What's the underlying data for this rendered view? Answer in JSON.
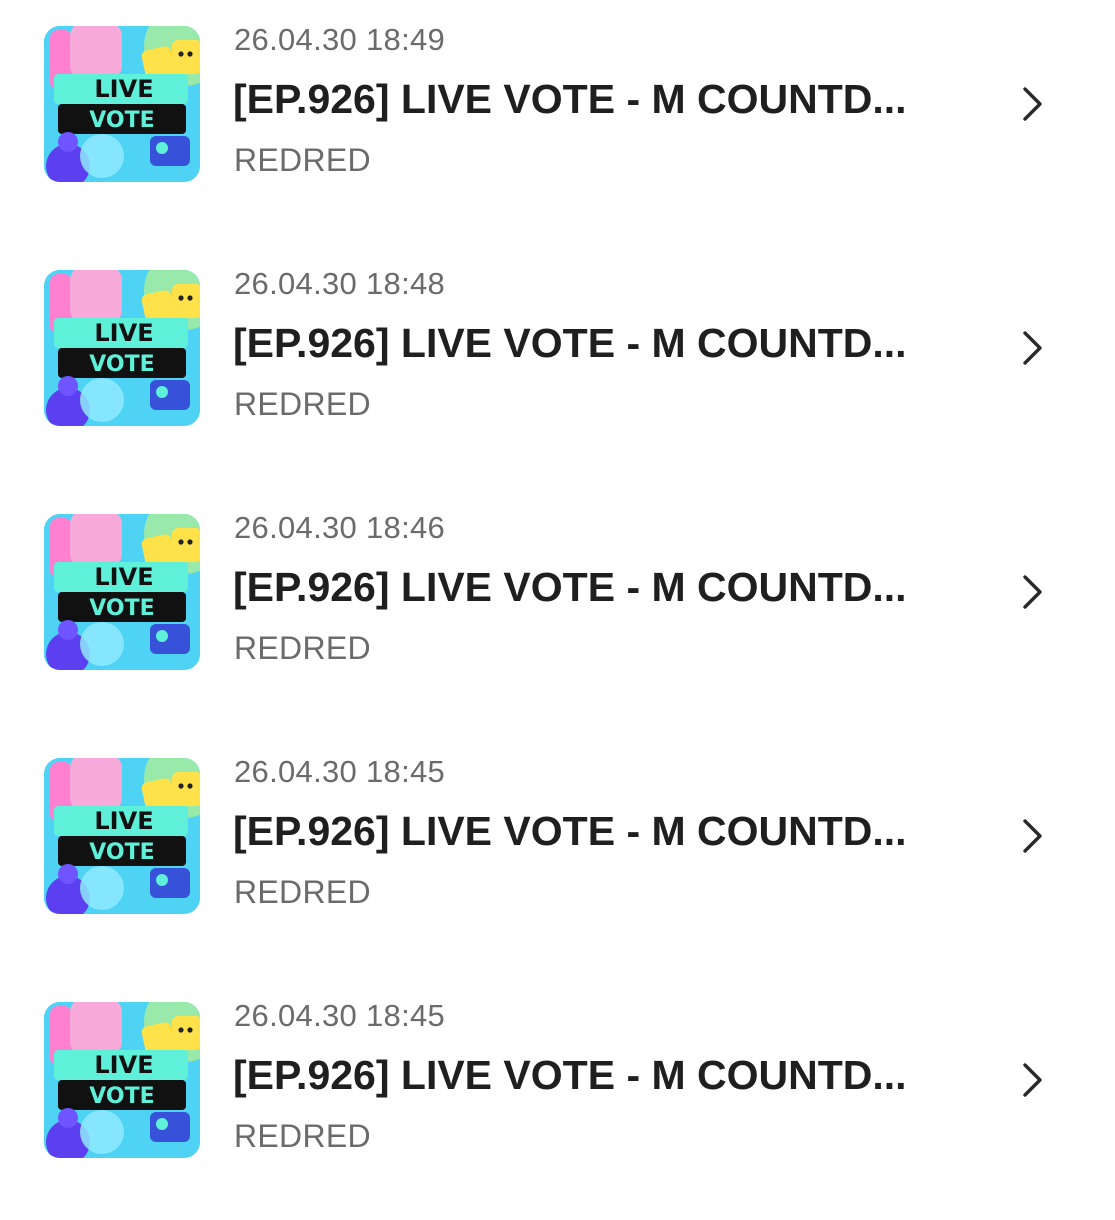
{
  "items": [
    {
      "date": "26.04.30 18:49",
      "title": "[EP.926] LIVE VOTE - M COUNTD...",
      "sender": "REDRED",
      "thumb_top": "LIVE",
      "thumb_bottom": "VOTE",
      "chevron_icon": "chevron-right-icon"
    },
    {
      "date": "26.04.30 18:48",
      "title": "[EP.926] LIVE VOTE - M COUNTD...",
      "sender": "REDRED",
      "thumb_top": "LIVE",
      "thumb_bottom": "VOTE",
      "chevron_icon": "chevron-right-icon"
    },
    {
      "date": "26.04.30 18:46",
      "title": "[EP.926] LIVE VOTE - M COUNTD...",
      "sender": "REDRED",
      "thumb_top": "LIVE",
      "thumb_bottom": "VOTE",
      "chevron_icon": "chevron-right-icon"
    },
    {
      "date": "26.04.30 18:45",
      "title": "[EP.926] LIVE VOTE - M COUNTD...",
      "sender": "REDRED",
      "thumb_top": "LIVE",
      "thumb_bottom": "VOTE",
      "chevron_icon": "chevron-right-icon"
    },
    {
      "date": "26.04.30 18:45",
      "title": "[EP.926] LIVE VOTE - M COUNTD...",
      "sender": "REDRED",
      "thumb_top": "LIVE",
      "thumb_bottom": "VOTE",
      "chevron_icon": "chevron-right-icon"
    }
  ],
  "colors": {
    "title": "#1f1f1f",
    "meta": "#6b6b6b",
    "chevron": "#2a2a2a",
    "banner": "#5ef0d8",
    "banner_dark": "#111111"
  }
}
